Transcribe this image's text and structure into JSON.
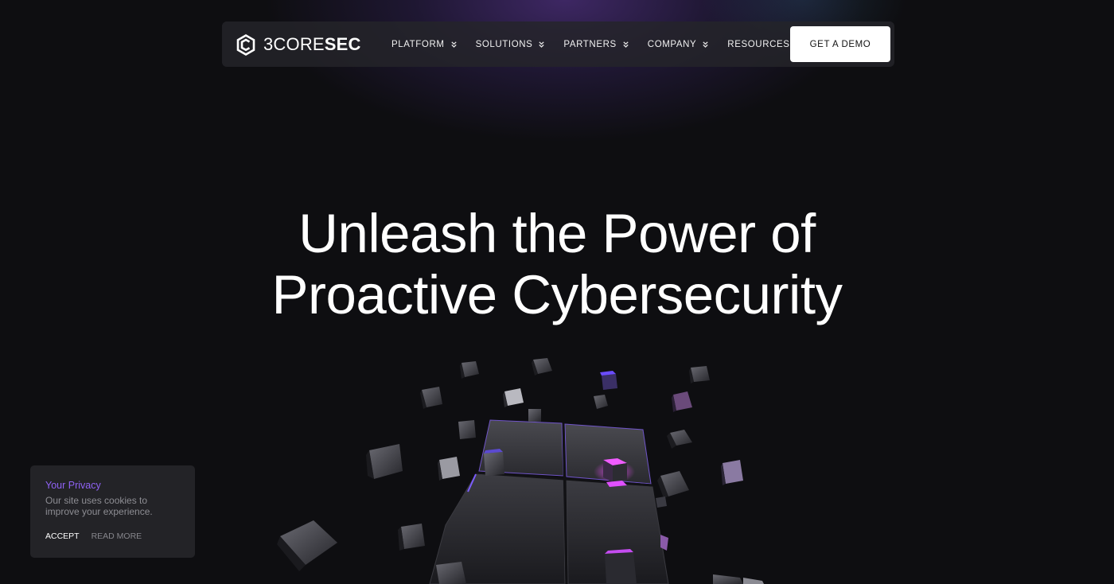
{
  "brand": {
    "name_light": "3CORE",
    "name_bold": "SEC"
  },
  "nav": {
    "items": [
      {
        "label": "PLATFORM"
      },
      {
        "label": "SOLUTIONS"
      },
      {
        "label": "PARTNERS"
      },
      {
        "label": "COMPANY"
      },
      {
        "label": "RESOURCES"
      }
    ],
    "cta_label": "GET A DEMO"
  },
  "hero": {
    "title_line1": "Unleash the Power of",
    "title_line2": "Proactive Cybersecurity"
  },
  "cookie_banner": {
    "title": "Your Privacy",
    "text": "Our site uses cookies to improve your experience.",
    "accept_label": "ACCEPT",
    "read_more_label": "READ MORE"
  },
  "colors": {
    "background": "#0e0e11",
    "accent_purple": "#8f62f5",
    "cube_glow": "#e040fb"
  },
  "icons": {
    "logo": "hexagon-logo-icon",
    "nav_chevron": "double-chevron-down-icon"
  }
}
